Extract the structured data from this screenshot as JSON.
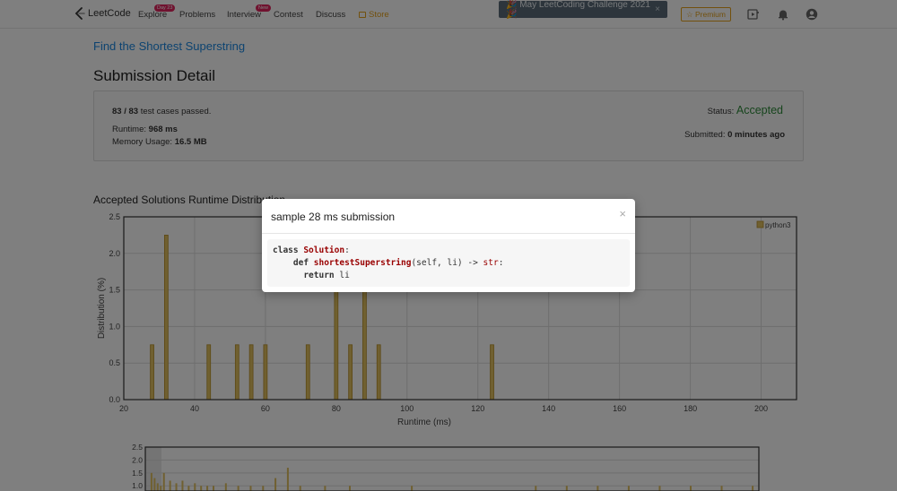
{
  "navbar": {
    "logo_text": "LeetCode",
    "items": [
      {
        "label": "Explore",
        "badge": "Day 23"
      },
      {
        "label": "Problems"
      },
      {
        "label": "Interview",
        "badge": "New"
      },
      {
        "label": "Contest"
      },
      {
        "label": "Discuss"
      },
      {
        "label": "Store"
      }
    ],
    "banner_text": "🎉 May LeetCoding Challenge 2021 🎉",
    "banner_close": "×",
    "premium_label": "☆ Premium",
    "accent_color": "#e4a11b",
    "icons": [
      "video-play-icon",
      "bell-icon",
      "user-avatar-icon"
    ]
  },
  "problem": {
    "title": "Find the Shortest Superstring"
  },
  "submission": {
    "heading": "Submission Detail",
    "test_cases_passed": "83 / 83",
    "test_cases_suffix": " test cases passed.",
    "runtime_label": "Runtime: ",
    "runtime_value": "968 ms",
    "memory_label": "Memory Usage: ",
    "memory_value": "16.5 MB",
    "status_label": "Status: ",
    "status_value": "Accepted",
    "submitted_label": "Submitted: ",
    "submitted_value": "0 minutes ago"
  },
  "distribution": {
    "title": "Accepted Solutions Runtime Distribution"
  },
  "modal": {
    "title": "sample 28 ms submission",
    "close": "×",
    "code": [
      [
        {
          "t": "class ",
          "c": "kw"
        },
        {
          "t": "Solution",
          "c": "cls"
        },
        {
          "t": ":",
          "c": ""
        }
      ],
      [
        {
          "t": "    def ",
          "c": "kw"
        },
        {
          "t": "shortestSuperstring",
          "c": "fn"
        },
        {
          "t": "(self, li) -> ",
          "c": ""
        },
        {
          "t": "str",
          "c": "ty"
        },
        {
          "t": ":",
          "c": ""
        }
      ],
      [
        {
          "t": "      return ",
          "c": "kw"
        },
        {
          "t": "li",
          "c": ""
        }
      ]
    ]
  },
  "chart_data": [
    {
      "type": "bar",
      "xlabel": "Runtime (ms)",
      "ylabel": "Distribution (%)",
      "xlim": [
        20,
        210
      ],
      "ylim": [
        0,
        2.5
      ],
      "xticks": [
        20,
        40,
        60,
        80,
        100,
        120,
        140,
        160,
        180,
        200
      ],
      "yticks": [
        0.0,
        0.5,
        1.0,
        1.5,
        2.0,
        2.5
      ],
      "grid": true,
      "legend_position": "top-right",
      "bar_width_ms": 1,
      "series": [
        {
          "name": "python3",
          "color": "#e0c060",
          "x": [
            28,
            32,
            44,
            52,
            56,
            60,
            72,
            80,
            84,
            88,
            92,
            124
          ],
          "values": [
            0.75,
            2.25,
            0.75,
            0.75,
            0.75,
            0.75,
            0.75,
            1.5,
            0.75,
            1.5,
            0.75,
            0.75
          ]
        }
      ]
    },
    {
      "type": "bar",
      "ylim": [
        0.8,
        2.5
      ],
      "yticks": [
        1.0,
        1.5,
        2.0,
        2.5
      ],
      "grid": true,
      "series": [
        {
          "name": "python3",
          "color": "#e0c060",
          "x": [
            16,
            17,
            18,
            19,
            20,
            22,
            24,
            26,
            28,
            30,
            32,
            34,
            36,
            40,
            44,
            48,
            52,
            56,
            60,
            64,
            72,
            80,
            100,
            140,
            150,
            160,
            170,
            180,
            190,
            200,
            210
          ],
          "values": [
            1.5,
            1.3,
            1.1,
            1.0,
            1.5,
            1.2,
            1.1,
            1.2,
            1.0,
            1.1,
            1.0,
            1.0,
            1.0,
            1.1,
            1.0,
            1.0,
            1.0,
            1.3,
            1.7,
            1.0,
            1.0,
            1.0,
            1.0,
            1.0,
            1.0,
            1.0,
            1.0,
            1.0,
            1.0,
            1.0,
            1.0
          ]
        }
      ]
    }
  ]
}
